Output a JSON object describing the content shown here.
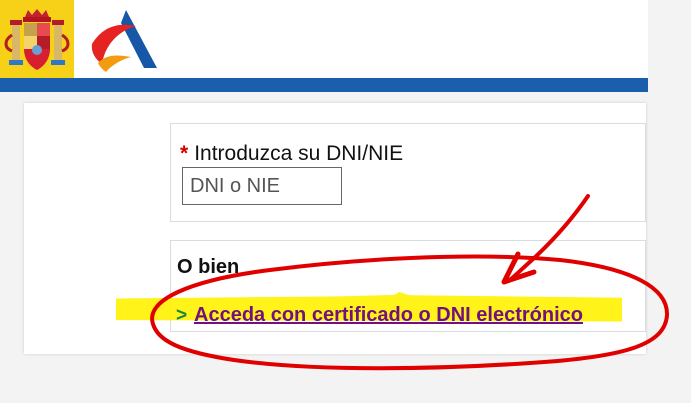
{
  "login": {
    "dni_label": "Introduzca su DNI/NIE",
    "required_marker": "*",
    "dni_placeholder": "DNI o NIE"
  },
  "alternative": {
    "title": "O bien",
    "arrow": ">",
    "link_text": "Acceda con certificado o DNI electrónico"
  },
  "annotation": {
    "color": "#e00000",
    "highlight_color": "#fff200"
  }
}
